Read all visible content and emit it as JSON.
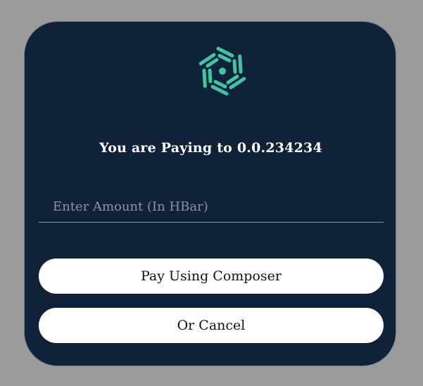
{
  "logo": {
    "icon": "hashpack-logo-icon",
    "color": "#3ec6a3"
  },
  "payment": {
    "title": "You are Paying to 0.0.234234",
    "amount_placeholder": "Enter Amount (In HBar)",
    "amount_value": ""
  },
  "actions": {
    "pay_label": "Pay Using Composer",
    "cancel_label": "Or Cancel"
  },
  "colors": {
    "backdrop": "#9b9b9b",
    "modal_bg": "#0f2239",
    "accent": "#3ec6a3",
    "button_bg": "#ffffff"
  }
}
